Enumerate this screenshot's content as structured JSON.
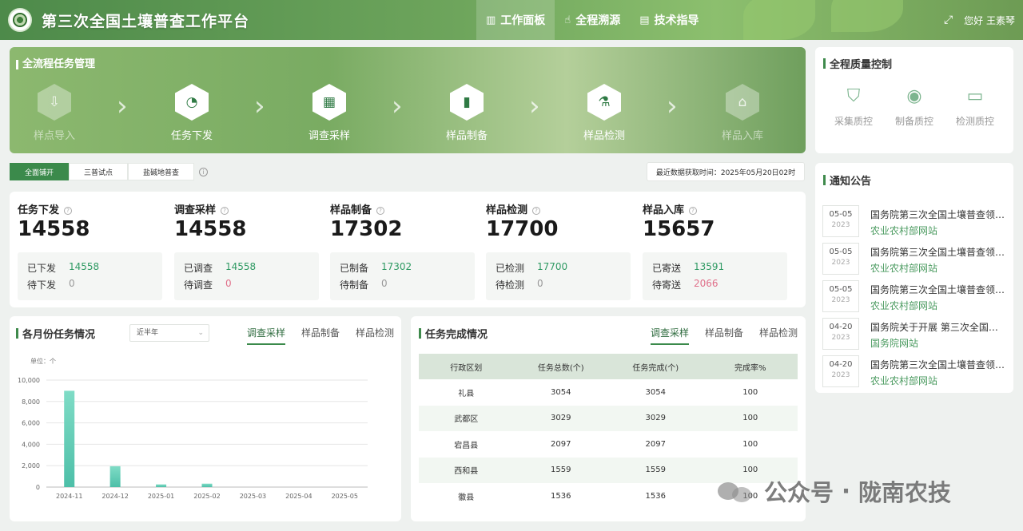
{
  "header": {
    "app_title": "第三次全国土壤普查工作平台",
    "nav": [
      {
        "label": "工作面板",
        "icon": "dashboard-icon",
        "active": true
      },
      {
        "label": "全程溯源",
        "icon": "trace-icon",
        "active": false
      },
      {
        "label": "技术指导",
        "icon": "guide-icon",
        "active": false
      }
    ],
    "greeting": "您好 王素琴"
  },
  "flow": {
    "title": "全流程任务管理",
    "steps": [
      {
        "label": "样点导入",
        "icon": "import-icon",
        "active": false
      },
      {
        "label": "任务下发",
        "icon": "dispatch-icon",
        "active": true
      },
      {
        "label": "调查采样",
        "icon": "sampling-icon",
        "active": true
      },
      {
        "label": "样品制备",
        "icon": "preparation-icon",
        "active": true
      },
      {
        "label": "样品检测",
        "icon": "testing-icon",
        "active": true
      },
      {
        "label": "样品入库",
        "icon": "storage-icon",
        "active": false
      }
    ]
  },
  "mode_tabs": [
    "全面铺开",
    "三普试点",
    "盐碱地普查"
  ],
  "refresh_time": "最近数据获取时间：2025年05月20日02时",
  "stats": [
    {
      "label": "任务下发",
      "value": "14558",
      "r1_label": "已下发",
      "r1_value": "14558",
      "r2_label": "待下发",
      "r2_value": "0",
      "r2_color": "#999999"
    },
    {
      "label": "调查采样",
      "value": "14558",
      "r1_label": "已调查",
      "r1_value": "14558",
      "r2_label": "待调查",
      "r2_value": "0",
      "r2_color": "#e0708a"
    },
    {
      "label": "样品制备",
      "value": "17302",
      "r1_label": "已制备",
      "r1_value": "17302",
      "r2_label": "待制备",
      "r2_value": "0",
      "r2_color": "#999999"
    },
    {
      "label": "样品检测",
      "value": "17700",
      "r1_label": "已检测",
      "r1_value": "17700",
      "r2_label": "待检测",
      "r2_value": "0",
      "r2_color": "#999999"
    },
    {
      "label": "样品入库",
      "value": "15657",
      "r1_label": "已寄送",
      "r1_value": "13591",
      "r2_label": "待寄送",
      "r2_value": "2066",
      "r2_color": "#e0708a"
    }
  ],
  "quality": {
    "title": "全程质量控制",
    "items": [
      {
        "label": "采集质控",
        "icon": "shield-search-icon"
      },
      {
        "label": "制备质控",
        "icon": "webcam-icon"
      },
      {
        "label": "检测质控",
        "icon": "monitor-pulse-icon"
      }
    ]
  },
  "notices": {
    "title": "通知公告",
    "items": [
      {
        "md": "05-05",
        "year": "2023",
        "title": "国务院第三次全国土壤普查领导小组办公室",
        "source": "农业农村部网站"
      },
      {
        "md": "05-05",
        "year": "2023",
        "title": "国务院第三次全国土壤普查领导小组办公室",
        "source": "农业农村部网站"
      },
      {
        "md": "05-05",
        "year": "2023",
        "title": "国务院第三次全国土壤普查领导小组办公室",
        "source": "农业农村部网站"
      },
      {
        "md": "04-20",
        "year": "2023",
        "title": "国务院关于开展 第三次全国土壤普查的通知",
        "source": "国务院网站"
      },
      {
        "md": "04-20",
        "year": "2023",
        "title": "国务院第三次全国土壤普查领导小组办公室",
        "source": "农业农村部网站"
      }
    ]
  },
  "monthly": {
    "title": "各月份任务情况",
    "select_value": "近半年",
    "tabs": [
      "调查采样",
      "样品制备",
      "样品检测"
    ],
    "unit": "单位：个"
  },
  "chart_data": {
    "type": "bar",
    "categories": [
      "2024-11",
      "2024-12",
      "2025-01",
      "2025-02",
      "2025-03",
      "2025-04",
      "2025-05"
    ],
    "values": [
      9000,
      1950,
      250,
      320,
      0,
      0,
      0
    ],
    "ylim": [
      0,
      10000
    ],
    "yticks": [
      "0",
      "2,000",
      "4,000",
      "6,000",
      "8,000",
      "10,000"
    ],
    "ytick_values": [
      0,
      2000,
      4000,
      6000,
      8000,
      10000
    ],
    "grid": true,
    "bar_color": "#4dbfa8"
  },
  "completion": {
    "title": "任务完成情况",
    "tabs": [
      "调查采样",
      "样品制备",
      "样品检测"
    ],
    "columns": [
      "行政区划",
      "任务总数(个)",
      "任务完成(个)",
      "完成率%"
    ],
    "rows": [
      [
        "礼县",
        "3054",
        "3054",
        "100"
      ],
      [
        "武都区",
        "3029",
        "3029",
        "100"
      ],
      [
        "宕昌县",
        "2097",
        "2097",
        "100"
      ],
      [
        "西和县",
        "1559",
        "1559",
        "100"
      ],
      [
        "徽县",
        "1536",
        "1536",
        "100"
      ]
    ]
  },
  "watermark": {
    "left": "公众号",
    "dot": "·",
    "right": "陇南农技"
  }
}
